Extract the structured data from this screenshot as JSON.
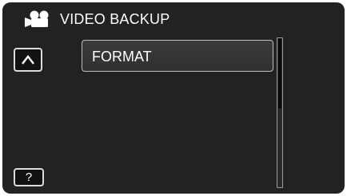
{
  "header": {
    "mode_icon": "video-camera-icon",
    "title": "VIDEO BACKUP"
  },
  "navigation": {
    "up_icon": "chevron-up-icon"
  },
  "menu": {
    "items": [
      {
        "label": "FORMAT"
      }
    ]
  },
  "scrollbar": {
    "thumb_position": 0,
    "visible_fraction": 0.47
  },
  "help": {
    "label": "?"
  },
  "colors": {
    "background": "#222222",
    "text": "#ffffff",
    "button_border": "#dcdcdc",
    "item_border": "#bdbdbd"
  }
}
